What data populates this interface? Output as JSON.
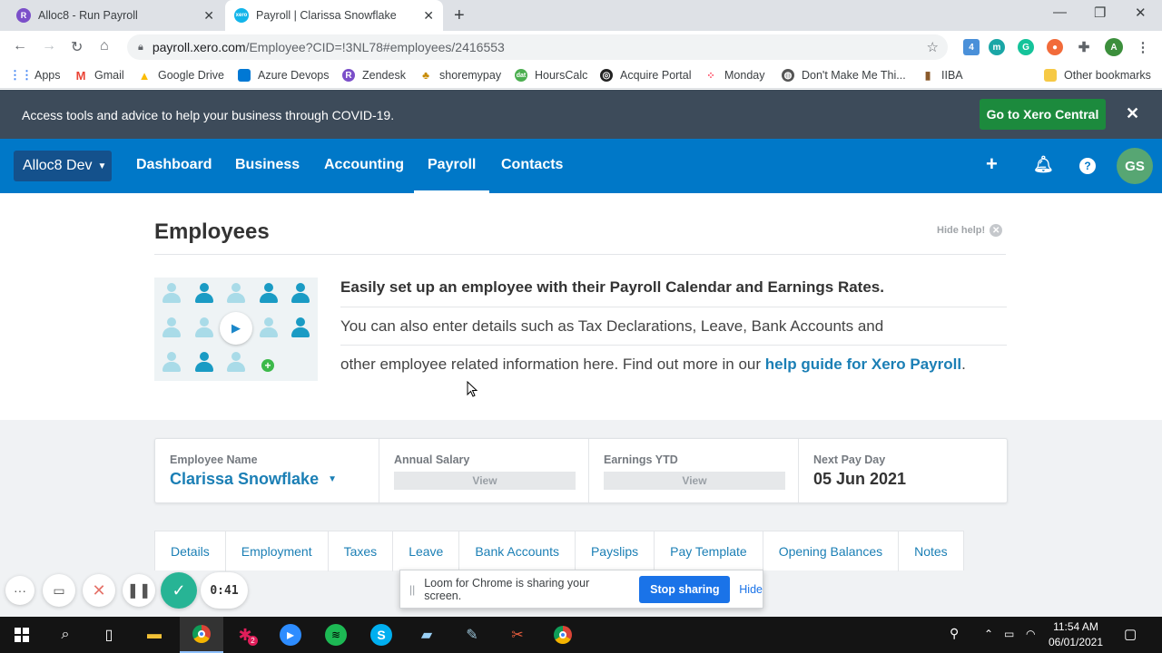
{
  "browser": {
    "tabs": [
      {
        "title": "Alloc8 - Run Payroll",
        "favicon": "R",
        "active": false
      },
      {
        "title": "Payroll | Clarissa Snowflake",
        "favicon": "xero",
        "active": true
      }
    ],
    "url_host": "payroll.xero.com",
    "url_path": "/Employee?CID=!3NL78#employees/2416553",
    "extensions": {
      "badge": "4",
      "m": "m",
      "g": "G",
      "avatar": "A"
    },
    "bookmarks": [
      "Apps",
      "Gmail",
      "Google Drive",
      "Azure Devops",
      "Zendesk",
      "shoremypay",
      "HoursCalc",
      "Acquire Portal",
      "Monday",
      "Don't Make Me Thi...",
      "IIBA"
    ],
    "other_bookmarks": "Other bookmarks"
  },
  "banner": {
    "message": "Access tools and advice to help your business through COVID-19.",
    "button": "Go to Xero Central"
  },
  "xero_nav": {
    "org": "Alloc8 Dev",
    "links": [
      "Dashboard",
      "Business",
      "Accounting",
      "Payroll",
      "Contacts"
    ],
    "active": "Payroll",
    "avatar": "GS"
  },
  "page": {
    "title": "Employees",
    "hide_help": "Hide help!",
    "help_heading": "Easily set up an employee with their Payroll Calendar and Earnings Rates.",
    "help_line1": "You can also enter details such as Tax Declarations, Leave, Bank Accounts and",
    "help_line2": "other employee related information here. Find out more in our ",
    "help_link": "help guide for Xero Payroll",
    "help_end": "."
  },
  "summary": {
    "employee_label": "Employee Name",
    "employee_name": "Clarissa Snowflake",
    "salary_label": "Annual Salary",
    "salary_button": "View",
    "ytd_label": "Earnings YTD",
    "ytd_button": "View",
    "payday_label": "Next Pay Day",
    "payday_value": "05 Jun 2021"
  },
  "subtabs": [
    "Details",
    "Employment",
    "Taxes",
    "Leave",
    "Bank Accounts",
    "Payslips",
    "Pay Template",
    "Opening Balances",
    "Notes"
  ],
  "loom": {
    "timer": "0:41",
    "message": "Loom for Chrome is sharing your screen.",
    "stop": "Stop sharing",
    "hide": "Hide"
  },
  "taskbar": {
    "time": "11:54 AM",
    "date": "06/01/2021",
    "slack_badge": "2"
  },
  "colors": {
    "xero_blue": "#0078c8",
    "banner": "#3d4b5a",
    "central_green": "#1c8a3d",
    "link_blue": "#1b7fb5"
  }
}
